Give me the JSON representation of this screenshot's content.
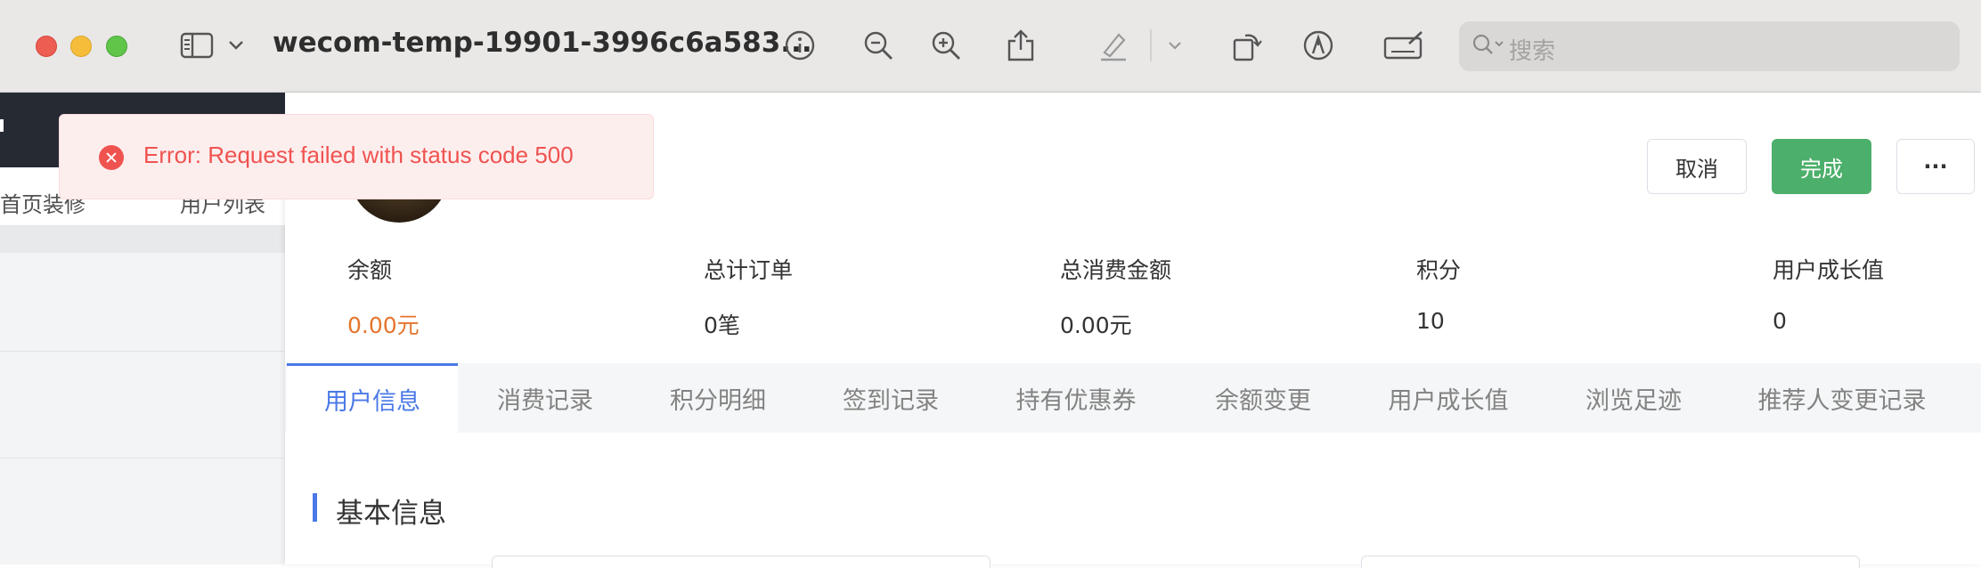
{
  "window": {
    "title": "wecom-temp-19901-3996c6a583...",
    "search_placeholder": "搜索"
  },
  "toolbar_icons": [
    "sidebar-icon",
    "chevron-down-icon",
    "info-icon",
    "zoom-out-icon",
    "zoom-in-icon",
    "share-icon",
    "highlight-pen-icon",
    "chevron-down-icon",
    "rotate-icon",
    "markup-icon",
    "signature-icon",
    "search-icon"
  ],
  "background_page": {
    "tabs": [
      {
        "label": "首页装修",
        "close": "^"
      },
      {
        "label": "用户列表",
        "close": "^"
      }
    ]
  },
  "toast": {
    "message": "Error: Request failed with status code 500",
    "type": "error",
    "color": "#ef5350"
  },
  "actions": {
    "cancel": "取消",
    "done": "完成",
    "more": "···"
  },
  "stats": [
    {
      "label": "余额",
      "value": "0.00元",
      "accent": true
    },
    {
      "label": "总计订单",
      "value": "0笔"
    },
    {
      "label": "总消费金额",
      "value": "0.00元"
    },
    {
      "label": "积分",
      "value": "10"
    },
    {
      "label": "用户成长值",
      "value": "0"
    }
  ],
  "tabs": [
    {
      "label": "用户信息",
      "active": true
    },
    {
      "label": "消费记录"
    },
    {
      "label": "积分明细"
    },
    {
      "label": "签到记录"
    },
    {
      "label": "持有优惠券"
    },
    {
      "label": "余额变更"
    },
    {
      "label": "用户成长值"
    },
    {
      "label": "浏览足迹"
    },
    {
      "label": "推荐人变更记录"
    }
  ],
  "section": {
    "title": "基本信息"
  },
  "colors": {
    "accent": "#4a78e6",
    "success": "#4caf6b",
    "balance": "#e4752e"
  }
}
